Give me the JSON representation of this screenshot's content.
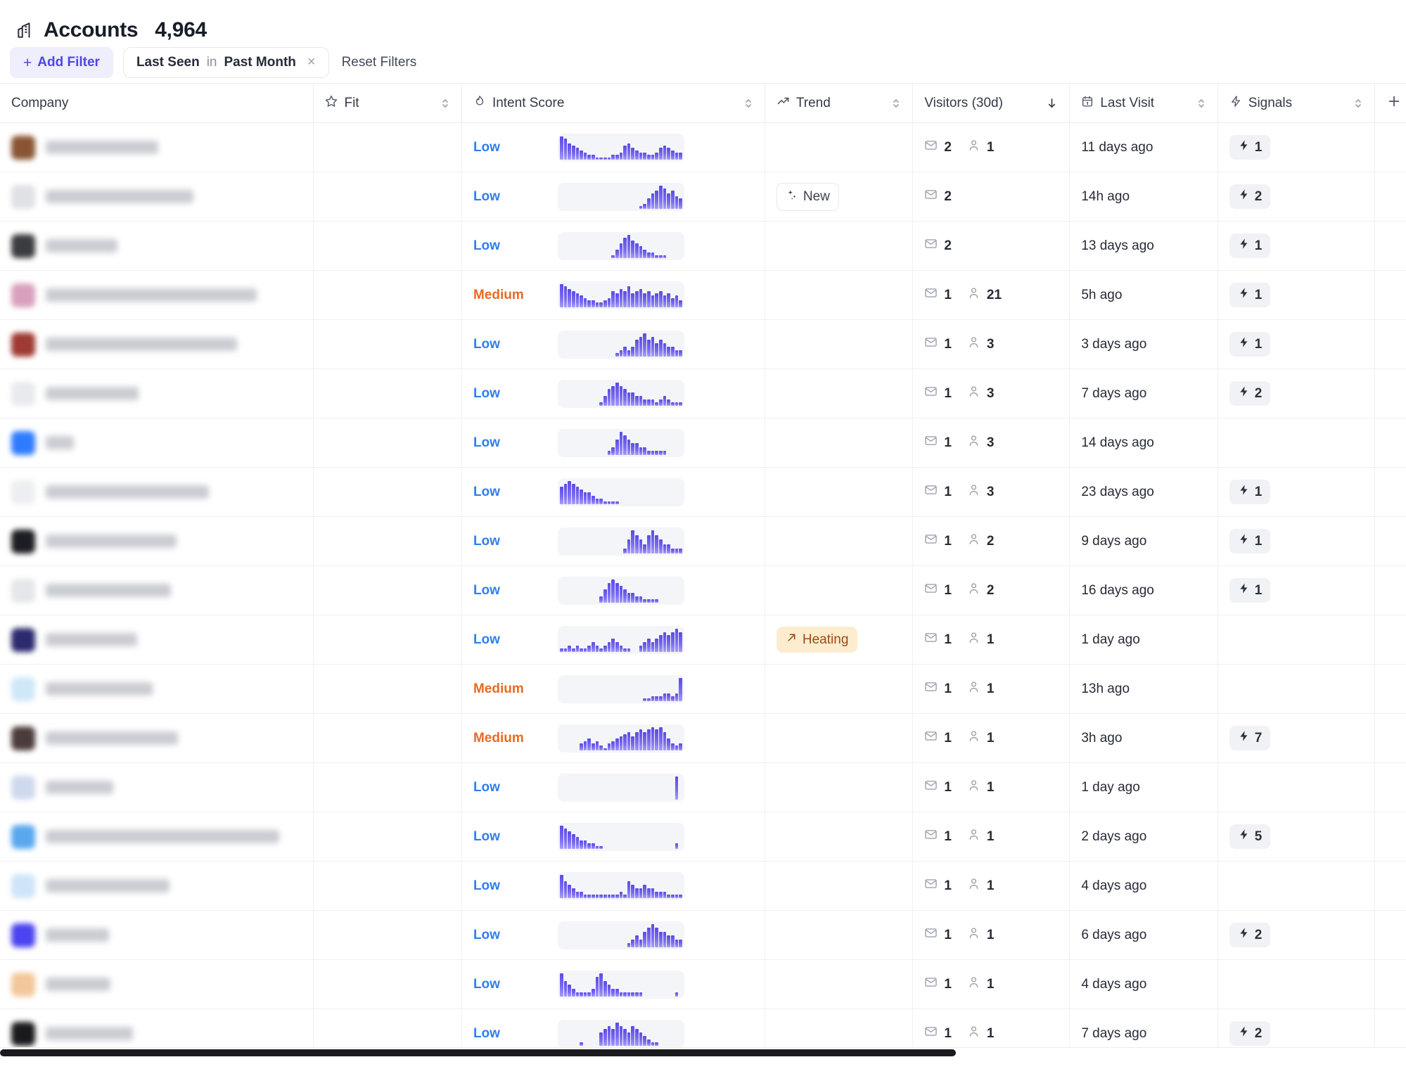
{
  "header": {
    "icon": "building-icon",
    "title": "Accounts",
    "count": "4,964"
  },
  "filters": {
    "add_filter_label": "Add Filter",
    "add_filter_plus": "+",
    "chip": {
      "field": "Last Seen",
      "operator": "in",
      "value": "Past Month",
      "remove": "×"
    },
    "reset_label": "Reset Filters"
  },
  "columns": [
    {
      "key": "company",
      "label": "Company",
      "icon": null,
      "sortable": false,
      "sort": null
    },
    {
      "key": "fit",
      "label": "Fit",
      "icon": "star-icon",
      "sortable": true,
      "sort": null
    },
    {
      "key": "intent",
      "label": "Intent Score",
      "icon": "flame-icon",
      "sortable": true,
      "sort": null
    },
    {
      "key": "trend",
      "label": "Trend",
      "icon": "trending-up-icon",
      "sortable": true,
      "sort": null
    },
    {
      "key": "visitors",
      "label": "Visitors (30d)",
      "icon": null,
      "sortable": true,
      "sort": "desc"
    },
    {
      "key": "lastvisit",
      "label": "Last Visit",
      "icon": "calendar-icon",
      "sortable": true,
      "sort": null
    },
    {
      "key": "signals",
      "label": "Signals",
      "icon": "bolt-icon",
      "sortable": true,
      "sort": null
    },
    {
      "key": "add",
      "label": "+",
      "icon": "plus-icon",
      "sortable": false,
      "sort": null
    }
  ],
  "colors": {
    "accent": "#4f46e5",
    "accent_bg": "#eeeefc",
    "intent_low": "#2f7fed",
    "intent_medium": "#ea6a24",
    "spark_bar": "#5b4ae8",
    "spark_track": "#f4f5f8",
    "heating_bg": "#fdeccd",
    "heating_text": "#9c4a14",
    "signal_pill_bg": "#f1f2f5",
    "scrollbar_thumb": "#1b1b1f"
  },
  "rows": [
    {
      "avatar_color": "#8a5433",
      "name_width": 160,
      "fit": "",
      "intent": "Low",
      "spark": [
        10,
        9,
        7,
        6,
        5,
        4,
        3,
        2,
        2,
        1,
        1,
        1,
        1,
        2,
        2,
        3,
        6,
        7,
        5,
        4,
        3,
        3,
        2,
        2,
        3,
        5,
        6,
        5,
        4,
        3,
        3
      ],
      "trend": null,
      "emails": "2",
      "people": "1",
      "last_visit": "11 days ago",
      "signals": "1"
    },
    {
      "avatar_color": "#dfe1e6",
      "name_width": 210,
      "fit": "",
      "intent": "Low",
      "spark": [
        0,
        0,
        0,
        0,
        0,
        0,
        0,
        0,
        0,
        0,
        0,
        0,
        0,
        0,
        0,
        0,
        0,
        0,
        0,
        0,
        1,
        2,
        4,
        6,
        7,
        9,
        8,
        6,
        7,
        5,
        4
      ],
      "trend": "New",
      "emails": "2",
      "people": "",
      "last_visit": "14h ago",
      "signals": "2"
    },
    {
      "avatar_color": "#3a3c40",
      "name_width": 102,
      "fit": "",
      "intent": "Low",
      "spark": [
        0,
        0,
        0,
        0,
        0,
        0,
        0,
        0,
        0,
        0,
        0,
        0,
        0,
        1,
        3,
        5,
        7,
        8,
        6,
        5,
        4,
        3,
        2,
        2,
        1,
        1,
        1,
        0,
        0,
        0,
        0
      ],
      "trend": null,
      "emails": "2",
      "people": "",
      "last_visit": "13 days ago",
      "signals": "1"
    },
    {
      "avatar_color": "#d9a0bd",
      "name_width": 300,
      "fit": "",
      "intent": "Medium",
      "spark": [
        10,
        9,
        8,
        7,
        6,
        5,
        4,
        3,
        3,
        2,
        2,
        3,
        4,
        7,
        6,
        8,
        7,
        9,
        6,
        7,
        8,
        6,
        7,
        5,
        6,
        7,
        5,
        6,
        4,
        5,
        3
      ],
      "trend": null,
      "emails": "1",
      "people": "21",
      "last_visit": "5h ago",
      "signals": "1"
    },
    {
      "avatar_color": "#9e3a32",
      "name_width": 272,
      "fit": "",
      "intent": "Low",
      "spark": [
        0,
        0,
        0,
        0,
        0,
        0,
        0,
        0,
        0,
        0,
        0,
        0,
        0,
        0,
        1,
        2,
        3,
        2,
        3,
        5,
        6,
        7,
        5,
        6,
        4,
        5,
        4,
        3,
        3,
        2,
        2
      ],
      "trend": null,
      "emails": "1",
      "people": "3",
      "last_visit": "3 days ago",
      "signals": "1"
    },
    {
      "avatar_color": "#e8eaee",
      "name_width": 132,
      "fit": "",
      "intent": "Low",
      "spark": [
        0,
        0,
        0,
        0,
        0,
        0,
        0,
        0,
        0,
        0,
        1,
        3,
        5,
        6,
        7,
        6,
        5,
        4,
        4,
        3,
        3,
        2,
        2,
        2,
        1,
        2,
        3,
        2,
        1,
        1,
        1
      ],
      "trend": null,
      "emails": "1",
      "people": "3",
      "last_visit": "7 days ago",
      "signals": "2"
    },
    {
      "avatar_color": "#2f7bff",
      "name_width": 40,
      "fit": "",
      "intent": "Low",
      "spark": [
        0,
        0,
        0,
        0,
        0,
        0,
        0,
        0,
        0,
        0,
        0,
        0,
        1,
        2,
        4,
        6,
        5,
        4,
        3,
        3,
        2,
        2,
        1,
        1,
        1,
        1,
        1,
        0,
        0,
        0,
        0
      ],
      "trend": null,
      "emails": "1",
      "people": "3",
      "last_visit": "14 days ago",
      "signals": ""
    },
    {
      "avatar_color": "#eceef1",
      "name_width": 232,
      "fit": "",
      "intent": "Low",
      "spark": [
        6,
        7,
        8,
        7,
        6,
        5,
        4,
        4,
        3,
        2,
        2,
        1,
        1,
        1,
        1,
        0,
        0,
        0,
        0,
        0,
        0,
        0,
        0,
        0,
        0,
        0,
        0,
        0,
        0,
        0,
        0
      ],
      "trend": null,
      "emails": "1",
      "people": "3",
      "last_visit": "23 days ago",
      "signals": "1"
    },
    {
      "avatar_color": "#1c1d22",
      "name_width": 186,
      "fit": "",
      "intent": "Low",
      "spark": [
        0,
        0,
        0,
        0,
        0,
        0,
        0,
        0,
        0,
        0,
        0,
        0,
        0,
        0,
        0,
        0,
        1,
        3,
        5,
        4,
        3,
        2,
        4,
        5,
        4,
        3,
        2,
        2,
        1,
        1,
        1
      ],
      "trend": null,
      "emails": "1",
      "people": "2",
      "last_visit": "9 days ago",
      "signals": "1"
    },
    {
      "avatar_color": "#e4e6ea",
      "name_width": 178,
      "fit": "",
      "intent": "Low",
      "spark": [
        0,
        0,
        0,
        0,
        0,
        0,
        0,
        0,
        0,
        0,
        2,
        4,
        6,
        7,
        6,
        5,
        4,
        3,
        3,
        2,
        2,
        1,
        1,
        1,
        1,
        0,
        0,
        0,
        0,
        0,
        0
      ],
      "trend": null,
      "emails": "1",
      "people": "2",
      "last_visit": "16 days ago",
      "signals": "1"
    },
    {
      "avatar_color": "#2c2a6e",
      "name_width": 130,
      "fit": "",
      "intent": "Low",
      "spark": [
        1,
        1,
        2,
        1,
        2,
        1,
        1,
        2,
        3,
        2,
        1,
        2,
        3,
        4,
        3,
        2,
        1,
        1,
        0,
        0,
        2,
        3,
        4,
        3,
        4,
        5,
        6,
        5,
        6,
        7,
        6
      ],
      "trend": "Heating",
      "emails": "1",
      "people": "1",
      "last_visit": "1 day ago",
      "signals": ""
    },
    {
      "avatar_color": "#cfe8f7",
      "name_width": 152,
      "fit": "",
      "intent": "Medium",
      "spark": [
        0,
        0,
        0,
        0,
        0,
        0,
        0,
        0,
        0,
        0,
        0,
        0,
        0,
        0,
        0,
        0,
        0,
        0,
        0,
        0,
        0,
        1,
        1,
        2,
        2,
        2,
        3,
        3,
        2,
        3,
        9
      ],
      "trend": null,
      "emails": "1",
      "people": "1",
      "last_visit": "13h ago",
      "signals": ""
    },
    {
      "avatar_color": "#4b3b3a",
      "name_width": 188,
      "fit": "",
      "intent": "Medium",
      "spark": [
        0,
        0,
        0,
        0,
        0,
        3,
        4,
        5,
        3,
        4,
        2,
        1,
        3,
        4,
        5,
        6,
        7,
        8,
        6,
        8,
        9,
        8,
        9,
        10,
        9,
        10,
        8,
        5,
        3,
        2,
        3
      ],
      "trend": null,
      "emails": "1",
      "people": "1",
      "last_visit": "3h ago",
      "signals": "7"
    },
    {
      "avatar_color": "#cfd9ee",
      "name_width": 96,
      "fit": "",
      "intent": "Low",
      "spark": [
        0,
        0,
        0,
        0,
        0,
        0,
        0,
        0,
        0,
        0,
        0,
        0,
        0,
        0,
        0,
        0,
        0,
        0,
        0,
        0,
        0,
        0,
        0,
        0,
        0,
        0,
        0,
        0,
        0,
        2,
        0
      ],
      "trend": null,
      "emails": "1",
      "people": "1",
      "last_visit": "1 day ago",
      "signals": ""
    },
    {
      "avatar_color": "#59a8ee",
      "name_width": 332,
      "fit": "",
      "intent": "Low",
      "spark": [
        8,
        7,
        6,
        5,
        4,
        3,
        3,
        2,
        2,
        1,
        1,
        0,
        0,
        0,
        0,
        0,
        0,
        0,
        0,
        0,
        0,
        0,
        0,
        0,
        0,
        0,
        0,
        0,
        0,
        2,
        0
      ],
      "trend": null,
      "emails": "1",
      "people": "1",
      "last_visit": "2 days ago",
      "signals": "5"
    },
    {
      "avatar_color": "#cfe4f9",
      "name_width": 176,
      "fit": "",
      "intent": "Low",
      "spark": [
        7,
        5,
        4,
        3,
        2,
        2,
        1,
        1,
        1,
        1,
        1,
        1,
        1,
        1,
        1,
        2,
        1,
        5,
        4,
        3,
        3,
        4,
        3,
        3,
        2,
        2,
        2,
        1,
        1,
        1,
        1
      ],
      "trend": null,
      "emails": "1",
      "people": "1",
      "last_visit": "4 days ago",
      "signals": ""
    },
    {
      "avatar_color": "#4b44f0",
      "name_width": 90,
      "fit": "",
      "intent": "Low",
      "spark": [
        0,
        0,
        0,
        0,
        0,
        0,
        0,
        0,
        0,
        0,
        0,
        0,
        0,
        0,
        0,
        0,
        0,
        1,
        2,
        3,
        2,
        4,
        5,
        6,
        5,
        4,
        4,
        3,
        3,
        2,
        2
      ],
      "trend": null,
      "emails": "1",
      "people": "1",
      "last_visit": "6 days ago",
      "signals": "2"
    },
    {
      "avatar_color": "#f2c79a",
      "name_width": 92,
      "fit": "",
      "intent": "Low",
      "spark": [
        6,
        4,
        3,
        2,
        1,
        1,
        1,
        1,
        2,
        5,
        6,
        4,
        3,
        2,
        2,
        1,
        1,
        1,
        1,
        1,
        1,
        0,
        0,
        0,
        0,
        0,
        0,
        0,
        0,
        1,
        0
      ],
      "trend": null,
      "emails": "1",
      "people": "1",
      "last_visit": "4 days ago",
      "signals": ""
    },
    {
      "avatar_color": "#1a1a1c",
      "name_width": 124,
      "fit": "",
      "intent": "Low",
      "spark": [
        0,
        0,
        0,
        0,
        0,
        1,
        0,
        0,
        0,
        0,
        4,
        5,
        6,
        5,
        7,
        6,
        5,
        4,
        6,
        5,
        4,
        3,
        2,
        1,
        1,
        0,
        0,
        0,
        0,
        0,
        0
      ],
      "trend": null,
      "emails": "1",
      "people": "1",
      "last_visit": "7 days ago",
      "signals": "2"
    }
  ],
  "scrollbar": {
    "orientation": "horizontal",
    "thumb_fraction": 0.68
  }
}
